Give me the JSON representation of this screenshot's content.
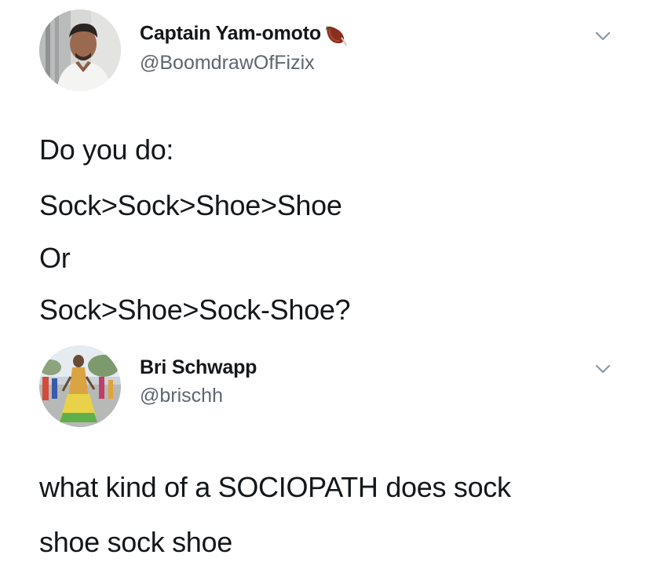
{
  "tweets": [
    {
      "display_name": "Captain Yam-omoto",
      "name_emoji": "sweet-potato-icon",
      "handle": "@BoomdrawOfFizix",
      "text_lines": [
        "Do you do:",
        "Sock>Sock>Shoe>Shoe",
        "Or",
        "Sock>Shoe>Sock-Shoe?"
      ]
    },
    {
      "display_name": "Bri Schwapp",
      "handle": "@brischh",
      "text_lines": [
        "what kind of a SOCIOPATH does sock",
        "shoe sock shoe"
      ]
    }
  ],
  "colors": {
    "text_primary": "#14171a",
    "text_secondary": "#5b6670",
    "background": "#ffffff",
    "chevron": "#8899a6"
  }
}
